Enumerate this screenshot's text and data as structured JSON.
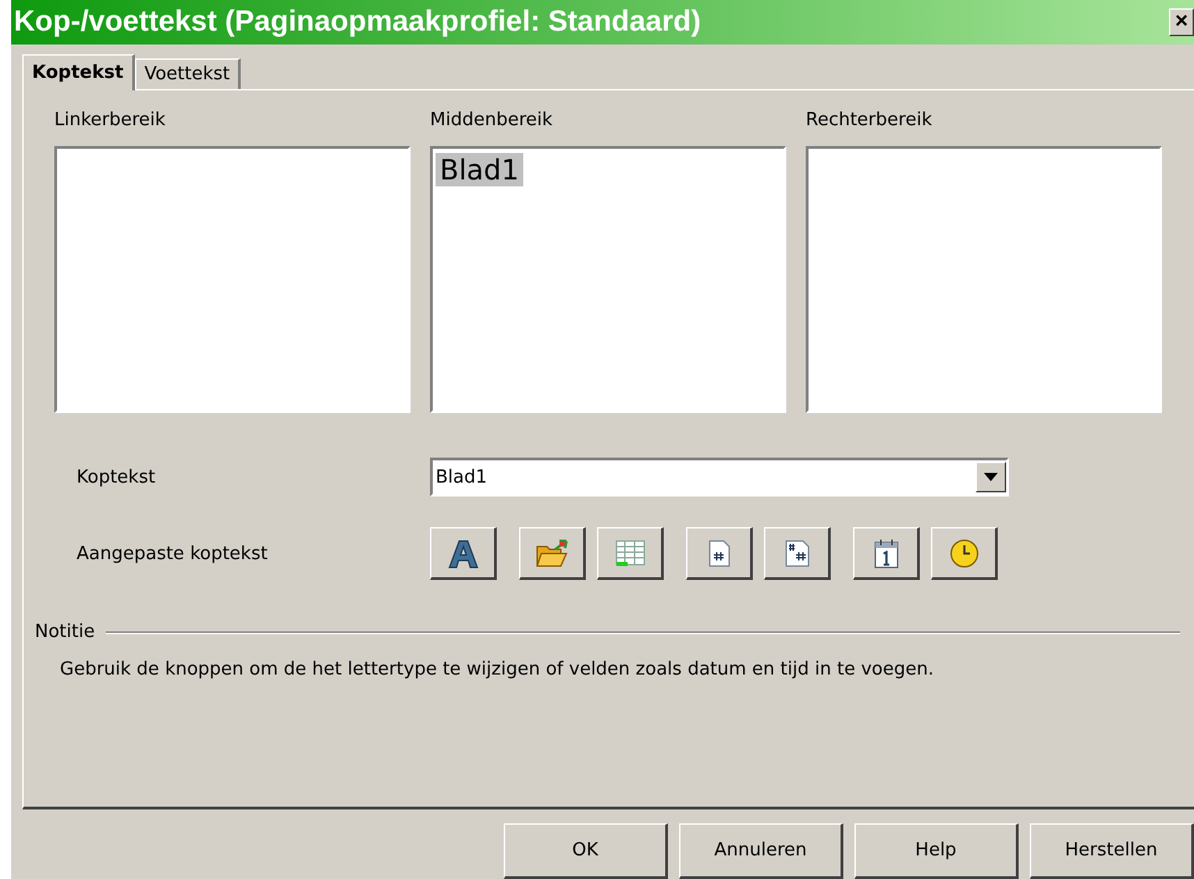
{
  "window": {
    "title": "Kop-/voettekst (Paginaopmaakprofiel: Standaard)",
    "close": "×"
  },
  "tabs": [
    {
      "label": "Koptekst",
      "selected": true
    },
    {
      "label": "Voettekst",
      "selected": false
    }
  ],
  "areas": [
    {
      "label": "Linkerbereik"
    },
    {
      "label": "Middenbereik",
      "text": "Blad1",
      "highlighted": true
    },
    {
      "label": "Rechterbereik"
    }
  ],
  "header": {
    "label": "Koptekst",
    "value": "Blad1"
  },
  "custom": {
    "label": "Aangepaste koptekst",
    "buttons": [
      {
        "kind": "font"
      },
      {
        "kind": "file"
      },
      {
        "kind": "sheet"
      },
      {
        "kind": "page"
      },
      {
        "kind": "pages"
      },
      {
        "kind": "date"
      },
      {
        "kind": "time"
      }
    ]
  },
  "note": {
    "title": "Notitie",
    "text": "Gebruik de knoppen om de het lettertype te wijzigen of velden zoals datum en tijd in te voegen."
  },
  "buttons": [
    "OK",
    "Annuleren",
    "Help",
    "Herstellen"
  ]
}
